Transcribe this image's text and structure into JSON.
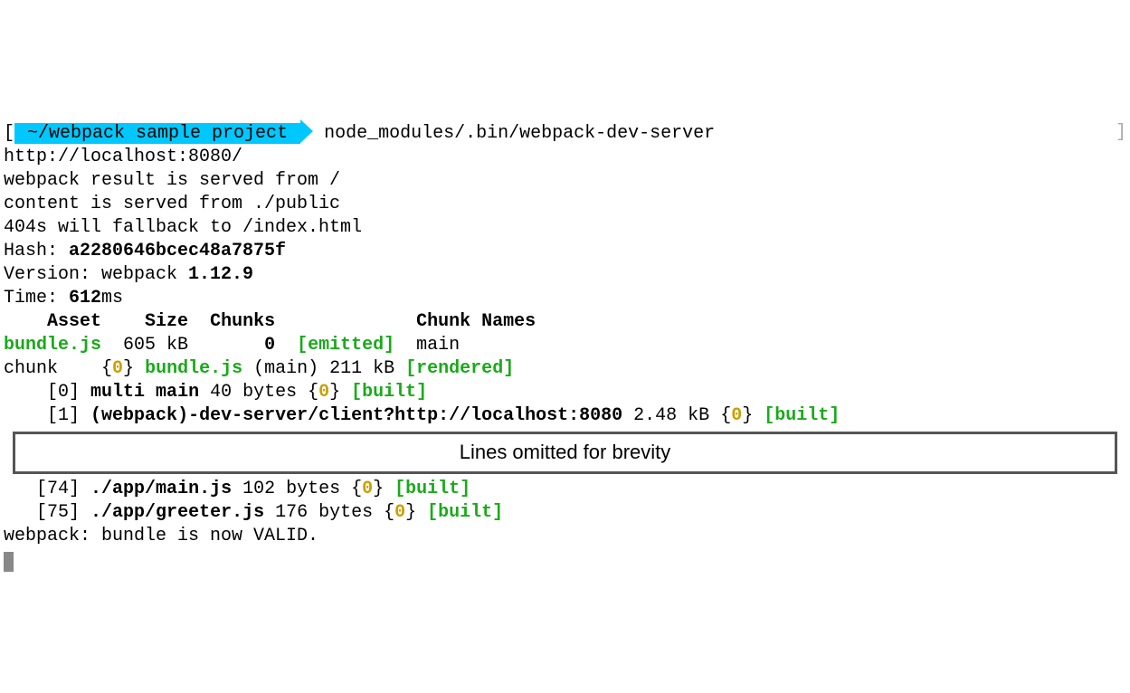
{
  "prompt": {
    "left_bracket": "[",
    "path": " ~/webpack sample project ",
    "right_bracket": "]",
    "command": " node_modules/.bin/webpack-dev-server"
  },
  "lines": {
    "url": "http://localhost:8080/",
    "served_from": "webpack result is served from /",
    "content_from": "content is served from ./public",
    "fallback": "404s will fallback to /index.html"
  },
  "hash": {
    "label": "Hash: ",
    "value": "a2280646bcec48a7875f"
  },
  "version": {
    "label": "Version: webpack ",
    "value": "1.12.9"
  },
  "time": {
    "label": "Time: ",
    "value": "612",
    "unit": "ms"
  },
  "table": {
    "header": {
      "asset": "Asset",
      "size": "Size",
      "chunks": "Chunks",
      "chunk_names": "Chunk Names"
    },
    "row": {
      "asset": "bundle.js",
      "size": "605 kB",
      "chunk": "0",
      "status": "[emitted]",
      "name": "main"
    }
  },
  "chunk_line": {
    "prefix": "chunk",
    "brace_num": "0",
    "file": "bundle.js",
    "name_paren": "(main)",
    "size": "211 kB",
    "status": "[rendered]"
  },
  "modules": [
    {
      "idx": "0",
      "name": "multi main",
      "size": "40 bytes",
      "brace": "0",
      "status": "[built]"
    },
    {
      "idx": "1",
      "name": "(webpack)-dev-server/client?http://localhost:8080",
      "size": "2.48 kB",
      "brace": "0",
      "status": "[built]"
    }
  ],
  "omitted": "Lines omitted for brevity",
  "modules_after": [
    {
      "idx": "74",
      "name": "./app/main.js",
      "size": "102 bytes",
      "brace": "0",
      "status": "[built]"
    },
    {
      "idx": "75",
      "name": "./app/greeter.js",
      "size": "176 bytes",
      "brace": "0",
      "status": "[built]"
    }
  ],
  "final": "webpack: bundle is now VALID."
}
